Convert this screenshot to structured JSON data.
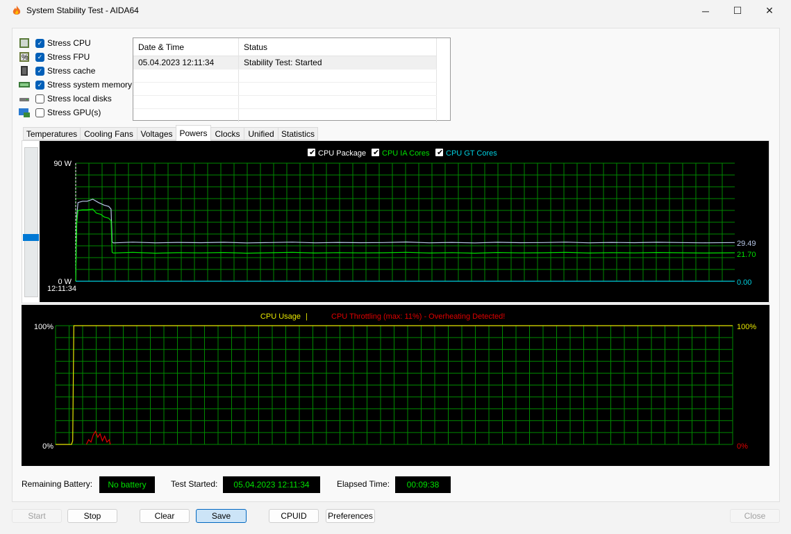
{
  "window": {
    "title": "System Stability Test - AIDA64",
    "minimize": "─",
    "maximize": "☐",
    "close": "✕"
  },
  "stress_options": [
    {
      "label": "Stress CPU",
      "checked": true,
      "icon": "cpu-chip-icon"
    },
    {
      "label": "Stress FPU",
      "checked": true,
      "icon": "fpu-chip-icon"
    },
    {
      "label": "Stress cache",
      "checked": true,
      "icon": "cache-chip-icon"
    },
    {
      "label": "Stress system memory",
      "checked": true,
      "icon": "memory-module-icon"
    },
    {
      "label": "Stress local disks",
      "checked": false,
      "icon": "disk-drive-icon"
    },
    {
      "label": "Stress GPU(s)",
      "checked": false,
      "icon": "monitor-gpu-icon"
    }
  ],
  "log": {
    "headers": [
      "Date & Time",
      "Status"
    ],
    "rows": [
      [
        "05.04.2023 12:11:34",
        "Stability Test: Started"
      ]
    ]
  },
  "tabs": [
    "Temperatures",
    "Cooling Fans",
    "Voltages",
    "Powers",
    "Clocks",
    "Unified",
    "Statistics"
  ],
  "active_tab": "Powers",
  "chart_data": [
    {
      "type": "line",
      "title": "Powers",
      "y_top_label": "90 W",
      "y_bottom_label": "0 W",
      "x_start_label": "12:11:34",
      "ylim": [
        0,
        90
      ],
      "xlim": [
        0,
        578
      ],
      "grid": true,
      "legend": [
        {
          "name": "CPU Package",
          "color": "#b8c8e8",
          "checked": true
        },
        {
          "name": "CPU IA Cores",
          "color": "#00e000",
          "checked": true
        },
        {
          "name": "CPU GT Cores",
          "color": "#00d0e0",
          "checked": true
        }
      ],
      "series": [
        {
          "name": "CPU Package",
          "color": "#b8c8e8",
          "current": "29.49",
          "x": [
            0,
            1,
            2,
            6,
            10,
            15,
            20,
            25,
            29,
            31,
            32,
            33,
            50,
            70,
            90,
            110,
            130,
            150,
            170,
            190,
            210,
            230,
            250,
            270,
            290,
            310,
            330,
            350,
            370,
            390,
            410,
            430,
            450,
            470,
            490,
            510,
            530,
            550,
            578
          ],
          "y": [
            0,
            50,
            60,
            61,
            61,
            62.5,
            60,
            58,
            57,
            55,
            30,
            29.2,
            29.8,
            29.3,
            29.6,
            29.4,
            29.7,
            29.2,
            29.5,
            29.8,
            29.3,
            29.6,
            29.4,
            29.5,
            29.9,
            29.3,
            29.6,
            29.2,
            29.7,
            29.4,
            29.5,
            29.8,
            29.3,
            29.6,
            29.4,
            29.7,
            29.5,
            29.3,
            29.49
          ]
        },
        {
          "name": "CPU IA Cores",
          "color": "#00e000",
          "current": "21.70",
          "x": [
            0,
            1,
            2,
            6,
            10,
            15,
            18,
            22,
            25,
            29,
            31,
            32,
            33,
            50,
            70,
            90,
            110,
            130,
            150,
            170,
            190,
            210,
            230,
            250,
            270,
            290,
            310,
            330,
            350,
            370,
            390,
            410,
            430,
            450,
            470,
            490,
            510,
            530,
            550,
            578
          ],
          "y": [
            0,
            45,
            54,
            54.5,
            54.5,
            55,
            52,
            51,
            49,
            48,
            46,
            22,
            21.5,
            22,
            21.4,
            21.8,
            21.6,
            21.9,
            21.4,
            21.7,
            22,
            21.5,
            21.8,
            21.6,
            21.7,
            22.1,
            21.5,
            21.8,
            21.4,
            21.9,
            21.6,
            21.7,
            22,
            21.5,
            21.8,
            21.6,
            21.9,
            21.7,
            21.5,
            21.7
          ]
        },
        {
          "name": "CPU GT Cores",
          "color": "#00d0e0",
          "current": "0.00",
          "x": [
            0,
            578
          ],
          "y": [
            0,
            0
          ]
        }
      ]
    },
    {
      "type": "line",
      "title": "CPU Usage",
      "subtitle": "CPU Throttling (max: 11%) - Overheating Detected!",
      "y_top_label": "100%",
      "y_bottom_label": "0%",
      "right_top_label": "100%",
      "right_bottom_label": "0%",
      "ylim": [
        0,
        100
      ],
      "xlim": [
        -15,
        578
      ],
      "grid": true,
      "series": [
        {
          "name": "CPU Usage",
          "color": "#e8e800",
          "x": [
            -15,
            -1,
            0,
            1,
            578
          ],
          "y": [
            0,
            0,
            3,
            100,
            100
          ]
        },
        {
          "name": "CPU Throttling",
          "color": "#e00000",
          "x": [
            12,
            14,
            16,
            18,
            20,
            22,
            24,
            26,
            28,
            30,
            32,
            33
          ],
          "y": [
            0,
            4,
            2,
            8,
            11,
            6,
            9,
            3,
            7,
            2,
            4,
            0
          ]
        }
      ]
    }
  ],
  "status": {
    "battery_label": "Remaining Battery:",
    "battery_value": "No battery",
    "started_label": "Test Started:",
    "started_value": "05.04.2023 12:11:34",
    "elapsed_label": "Elapsed Time:",
    "elapsed_value": "00:09:38"
  },
  "buttons": {
    "start": "Start",
    "stop": "Stop",
    "clear": "Clear",
    "save": "Save",
    "cpuid": "CPUID",
    "preferences": "Preferences",
    "close": "Close"
  }
}
